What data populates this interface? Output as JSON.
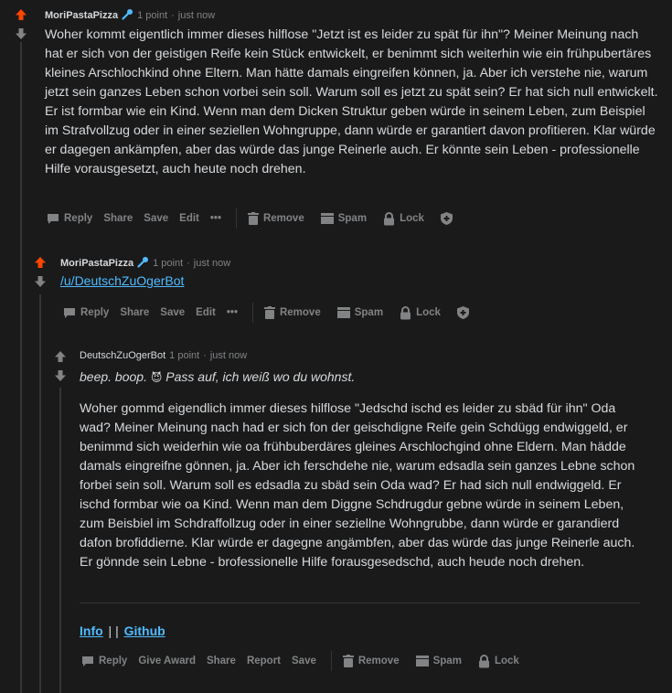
{
  "comment1": {
    "author": "MoriPastaPizza",
    "points": "1 point",
    "dot": "·",
    "time": "just now",
    "body": "Woher kommt eigentlich immer dieses hilflose \"Jetzt ist es leider zu spät für ihn\"? Meiner Meinung nach hat er sich von der geistigen Reife kein Stück entwickelt, er benimmt sich weiterhin wie ein frühpubertäres kleines Arschlochkind ohne Eltern. Man hätte damals eingreifen können, ja. Aber ich verstehe nie, warum jetzt sein ganzes Leben schon vorbei sein soll. Warum soll es jetzt zu spät sein? Er hat sich null entwickelt. Er ist formbar wie ein Kind. Wenn man dem Dicken Struktur geben würde in seinem Leben, zum Beispiel im Strafvollzug oder in einer seziellen Wohngruppe, dann würde er garantiert davon profitieren. Klar würde er dagegen ankämpfen, aber das würde das junge Reinerle auch. Er könnte sein Leben - professionelle Hilfe vorausgesetzt, auch heute noch drehen.",
    "actions": {
      "reply": "Reply",
      "share": "Share",
      "save": "Save",
      "edit": "Edit",
      "more": "•••",
      "remove": "Remove",
      "spam": "Spam",
      "lock": "Lock"
    }
  },
  "comment2": {
    "author": "MoriPastaPizza",
    "points": "1 point",
    "dot": "·",
    "time": "just now",
    "link": "/u/DeutschZuOgerBot",
    "actions": {
      "reply": "Reply",
      "share": "Share",
      "save": "Save",
      "edit": "Edit",
      "more": "•••",
      "remove": "Remove",
      "spam": "Spam",
      "lock": "Lock"
    }
  },
  "comment3": {
    "author": "DeutschZuOgerBot",
    "points": "1 point",
    "dot": "·",
    "time": "just now",
    "intro_a": "beep. boop.",
    "intro_emoji": "😈",
    "intro_b": "Pass auf, ich weiß wo du wohnst.",
    "body": "Woher gommd eigendlich immer dieses hilflose \"Jedschd ischd es leider zu sbäd für ihn\" Oda wad? Meiner Meinung nach had er sich fon der geischdigne Reife gein Schdügg endwiggeld, er benimmd sich weiderhin wie oa frühbuberdäres gleines Arschlochgind ohne Eldern. Man hädde damals eingreifne gönnen, ja. Aber ich ferschdehe nie, warum edsadla sein ganzes Lebne schon forbei sein soll. Warum soll es edsadla zu sbäd sein Oda wad? Er had sich null endwiggeld. Er ischd formbar wie oa Kind. Wenn man dem Diggne Schdrugdur gebne würde in seinem Leben, zum Beisbiel im Schdraffollzug oder in einer seziellne Wohngrubbe, dann würde er garandierd dafon brofiddierne. Klar würde er dagegne angämbfen, aber das würde das junge Reinerle auch. Er gönnde sein Lebne - brofessionelle Hilfe forausgesedschd, auch heude noch drehen.",
    "footer_info": "Info",
    "footer_sep": "| |",
    "footer_github": "Github",
    "actions": {
      "reply": "Reply",
      "award": "Give Award",
      "share": "Share",
      "report": "Report",
      "save": "Save",
      "remove": "Remove",
      "spam": "Spam",
      "lock": "Lock"
    }
  },
  "colors": {
    "upvote": "#ff4500",
    "link": "#4fbcff",
    "mic": "#4fbcff"
  }
}
